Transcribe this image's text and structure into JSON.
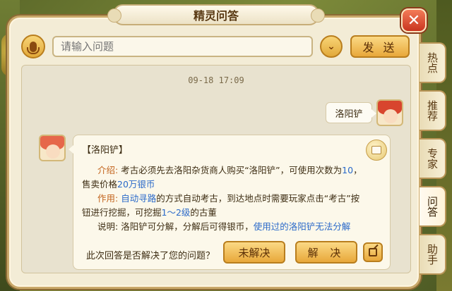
{
  "window": {
    "title": "精灵问答"
  },
  "input": {
    "placeholder": "请输入问题",
    "send_label": "发 送"
  },
  "chat": {
    "timestamp": "09-18 17:09",
    "user_message": "洛阳铲",
    "answer": {
      "title": "【洛阳铲】",
      "intro_label": "介绍:",
      "intro_text_1": "考古必须先去洛阳杂货商人购买“洛阳铲”，可使用次数为",
      "intro_count": "10",
      "intro_text_2": "，",
      "intro_line2_prefix": "售卖价格",
      "intro_price": "20万银币",
      "usage_label": "作用:",
      "usage_link": "自动寻路",
      "usage_text_1": "的方式自动考古，到达地点时需要玩家点击“考古”按",
      "usage_text_2_prefix": "钮进行挖掘，可挖掘",
      "usage_range": "1～2级",
      "usage_text_2_suffix": "的古董",
      "note_label": "说明:",
      "note_text": "洛阳铲可分解，分解后可得银币，",
      "note_highlight": "使用过的洛阳铲无法分解"
    },
    "feedback": {
      "question": "此次回答是否解决了您的问题？",
      "unresolved_label": "未解决",
      "resolved_label": "解 决"
    }
  },
  "side_tabs": [
    "热点",
    "推荐",
    "专家",
    "问答",
    "助手"
  ],
  "active_tab": "问答",
  "colors": {
    "accent": "#e8a83a",
    "link": "#2a69c9",
    "label": "#c2631c",
    "panel": "#f3ecd6"
  }
}
